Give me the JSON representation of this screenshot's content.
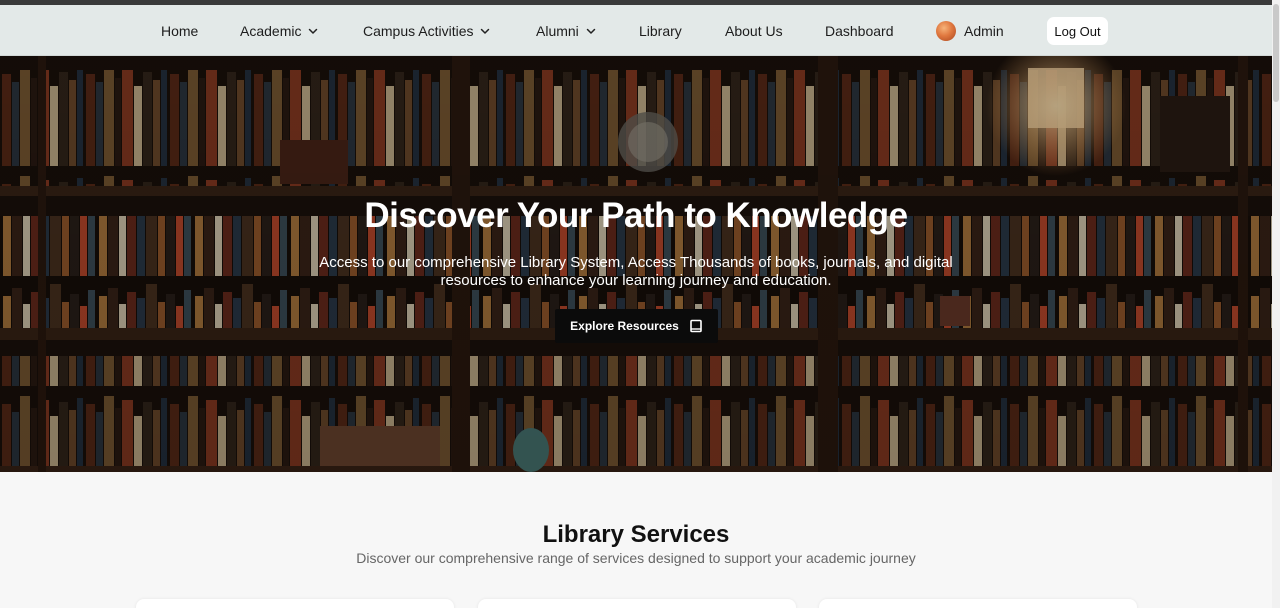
{
  "nav": {
    "home": "Home",
    "academic": "Academic",
    "campus_activities": "Campus Activities",
    "alumni": "Alumni",
    "library": "Library",
    "about_us": "About Us",
    "dashboard": "Dashboard",
    "admin": "Admin",
    "logout": "Log Out",
    "icons": {
      "dropdown": "chevron-down-icon",
      "avatar": "user-avatar"
    }
  },
  "hero": {
    "title": "Discover Your Path to Knowledge",
    "subtitle": "Access to our comprehensive Library System, Access Thousands of books, journals, and digital resources to enhance your learning journey and education.",
    "button_label": "Explore Resources",
    "button_icon": "book-icon",
    "background": "library-bookshelf-photo"
  },
  "services": {
    "title": "Library Services",
    "subtitle": "Discover our comprehensive range of services designed to support your academic journey"
  },
  "colors": {
    "navbar_bg": "#e3e9e8",
    "button_bg": "#0b0b0b",
    "page_bg": "#f7f7f7"
  }
}
